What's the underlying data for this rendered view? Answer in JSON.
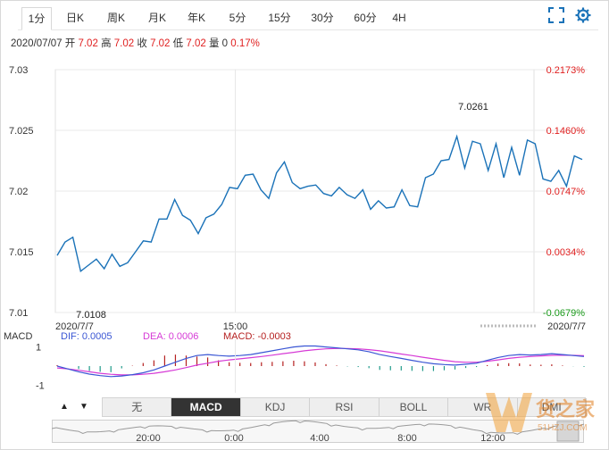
{
  "tabs": [
    "1分",
    "日K",
    "周K",
    "月K",
    "年K",
    "5分",
    "15分",
    "30分",
    "60分",
    "4H"
  ],
  "active_tab": "1分",
  "toolbar": {
    "fullscreen_icon": "fullscreen-icon",
    "settings_icon": "gear-icon"
  },
  "quote": {
    "date": "2020/07/07",
    "open_label": "开",
    "open": "7.02",
    "high_label": "高",
    "high": "7.02",
    "close_label": "收",
    "close": "7.02",
    "low_label": "低",
    "low": "7.02",
    "volume_label": "量",
    "volume": "0",
    "change": "0.17%"
  },
  "chart_data": [
    {
      "type": "line",
      "title": "",
      "xlabel": "",
      "ylabel": "",
      "ylim": [
        7.01,
        7.03
      ],
      "y_ticks": [
        "7.03",
        "7.025",
        "7.02",
        "7.015",
        "7.01"
      ],
      "y_tick_values": [
        7.03,
        7.025,
        7.02,
        7.015,
        7.01
      ],
      "pct_ticks": [
        {
          "label": "0.2173%",
          "value": 7.03,
          "color": "#e02020"
        },
        {
          "label": "0.1460%",
          "value": 7.025,
          "color": "#e02020"
        },
        {
          "label": "0.0747%",
          "value": 7.02,
          "color": "#e02020"
        },
        {
          "label": "0.0034%",
          "value": 7.015,
          "color": "#e02020"
        },
        {
          "label": "-0.0679%",
          "value": 7.01,
          "color": "#1a9a1a"
        }
      ],
      "x_ticks": [
        {
          "label": "2020/7/7",
          "pos": 0.0
        },
        {
          "label": "15:00",
          "pos": 0.376
        },
        {
          "label": "2020/7/7",
          "pos": 1.0
        }
      ],
      "annotations": {
        "max_label": "7.0261",
        "max_index": 62,
        "min_label": "7.0108",
        "min_index": 3
      },
      "line_color": "#1a72b8",
      "grid": true,
      "values": [
        7.0147,
        7.0158,
        7.0162,
        7.0134,
        7.0139,
        7.0144,
        7.0136,
        7.0148,
        7.0138,
        7.0141,
        7.015,
        7.0159,
        7.0158,
        7.0177,
        7.0177,
        7.0193,
        7.018,
        7.0176,
        7.0165,
        7.0178,
        7.0181,
        7.0189,
        7.0203,
        7.0202,
        7.0213,
        7.0214,
        7.0201,
        7.0194,
        7.0215,
        7.0224,
        7.0207,
        7.0202,
        7.0204,
        7.0205,
        7.0198,
        7.0196,
        7.0203,
        7.0197,
        7.0194,
        7.0201,
        7.0185,
        7.0192,
        7.0186,
        7.0187,
        7.0201,
        7.0188,
        7.0187,
        7.0211,
        7.0214,
        7.0225,
        7.0226,
        7.0245,
        7.0219,
        7.0241,
        7.0239,
        7.0217,
        7.0239,
        7.0211,
        7.0236,
        7.0213,
        7.0242,
        7.0239,
        7.021,
        7.0208,
        7.0217,
        7.0204,
        7.0229,
        7.0226
      ]
    },
    {
      "type": "bar",
      "title": "MACD",
      "legend": [
        {
          "label": "DIF: 0.0005",
          "color": "#3a56d4"
        },
        {
          "label": "DEA: 0.0006",
          "color": "#d63ad6"
        },
        {
          "label": "MACD: -0.0003",
          "color": "#b52020"
        }
      ],
      "y_ticks": [
        "1",
        "-1"
      ],
      "y_tick_values": [
        1,
        -1
      ],
      "ylim": [
        -1.4,
        1.4
      ],
      "dif": [
        0.0,
        -0.15,
        -0.3,
        -0.42,
        -0.5,
        -0.55,
        -0.52,
        -0.45,
        -0.35,
        -0.2,
        0.0,
        0.2,
        0.4,
        0.55,
        0.6,
        0.55,
        0.52,
        0.55,
        0.6,
        0.7,
        0.8,
        0.9,
        1.0,
        1.05,
        1.05,
        1.0,
        0.95,
        0.9,
        0.85,
        0.75,
        0.6,
        0.5,
        0.4,
        0.3,
        0.2,
        0.12,
        0.08,
        0.05,
        0.1,
        0.15,
        0.3,
        0.45,
        0.55,
        0.6,
        0.58,
        0.6,
        0.65,
        0.6,
        0.55,
        0.5
      ],
      "dea": [
        -0.1,
        -0.15,
        -0.22,
        -0.3,
        -0.38,
        -0.43,
        -0.46,
        -0.46,
        -0.43,
        -0.38,
        -0.3,
        -0.2,
        -0.08,
        0.05,
        0.15,
        0.25,
        0.32,
        0.38,
        0.44,
        0.5,
        0.57,
        0.65,
        0.72,
        0.8,
        0.86,
        0.9,
        0.92,
        0.92,
        0.9,
        0.86,
        0.8,
        0.72,
        0.63,
        0.55,
        0.46,
        0.38,
        0.3,
        0.23,
        0.2,
        0.2,
        0.25,
        0.32,
        0.4,
        0.46,
        0.5,
        0.53,
        0.56,
        0.57,
        0.56,
        0.54
      ],
      "macd": [
        0.05,
        0.0,
        -0.15,
        -0.25,
        -0.3,
        -0.32,
        -0.12,
        0.02,
        0.16,
        0.3,
        0.55,
        0.6,
        0.55,
        0.5,
        0.45,
        0.3,
        0.2,
        0.17,
        0.16,
        0.2,
        0.22,
        0.25,
        0.28,
        0.25,
        0.19,
        0.1,
        0.03,
        -0.02,
        -0.05,
        -0.11,
        -0.2,
        -0.22,
        -0.23,
        -0.25,
        -0.26,
        -0.26,
        -0.22,
        -0.18,
        -0.1,
        -0.05,
        0.05,
        0.13,
        0.15,
        0.14,
        0.08,
        0.07,
        0.09,
        0.03,
        -0.01,
        -0.04
      ]
    }
  ],
  "indicator_buttons": {
    "up_icon": "▲",
    "down_icon": "▼",
    "items": [
      "无",
      "MACD",
      "KDJ",
      "RSI",
      "BOLL",
      "WR",
      "DMI"
    ],
    "active": "MACD"
  },
  "navigator": {
    "labels": [
      "20:00",
      "0:00",
      "4:00",
      "8:00",
      "12:00"
    ]
  },
  "watermark": {
    "text": "货之家",
    "sub": "51HZJ.COM"
  }
}
